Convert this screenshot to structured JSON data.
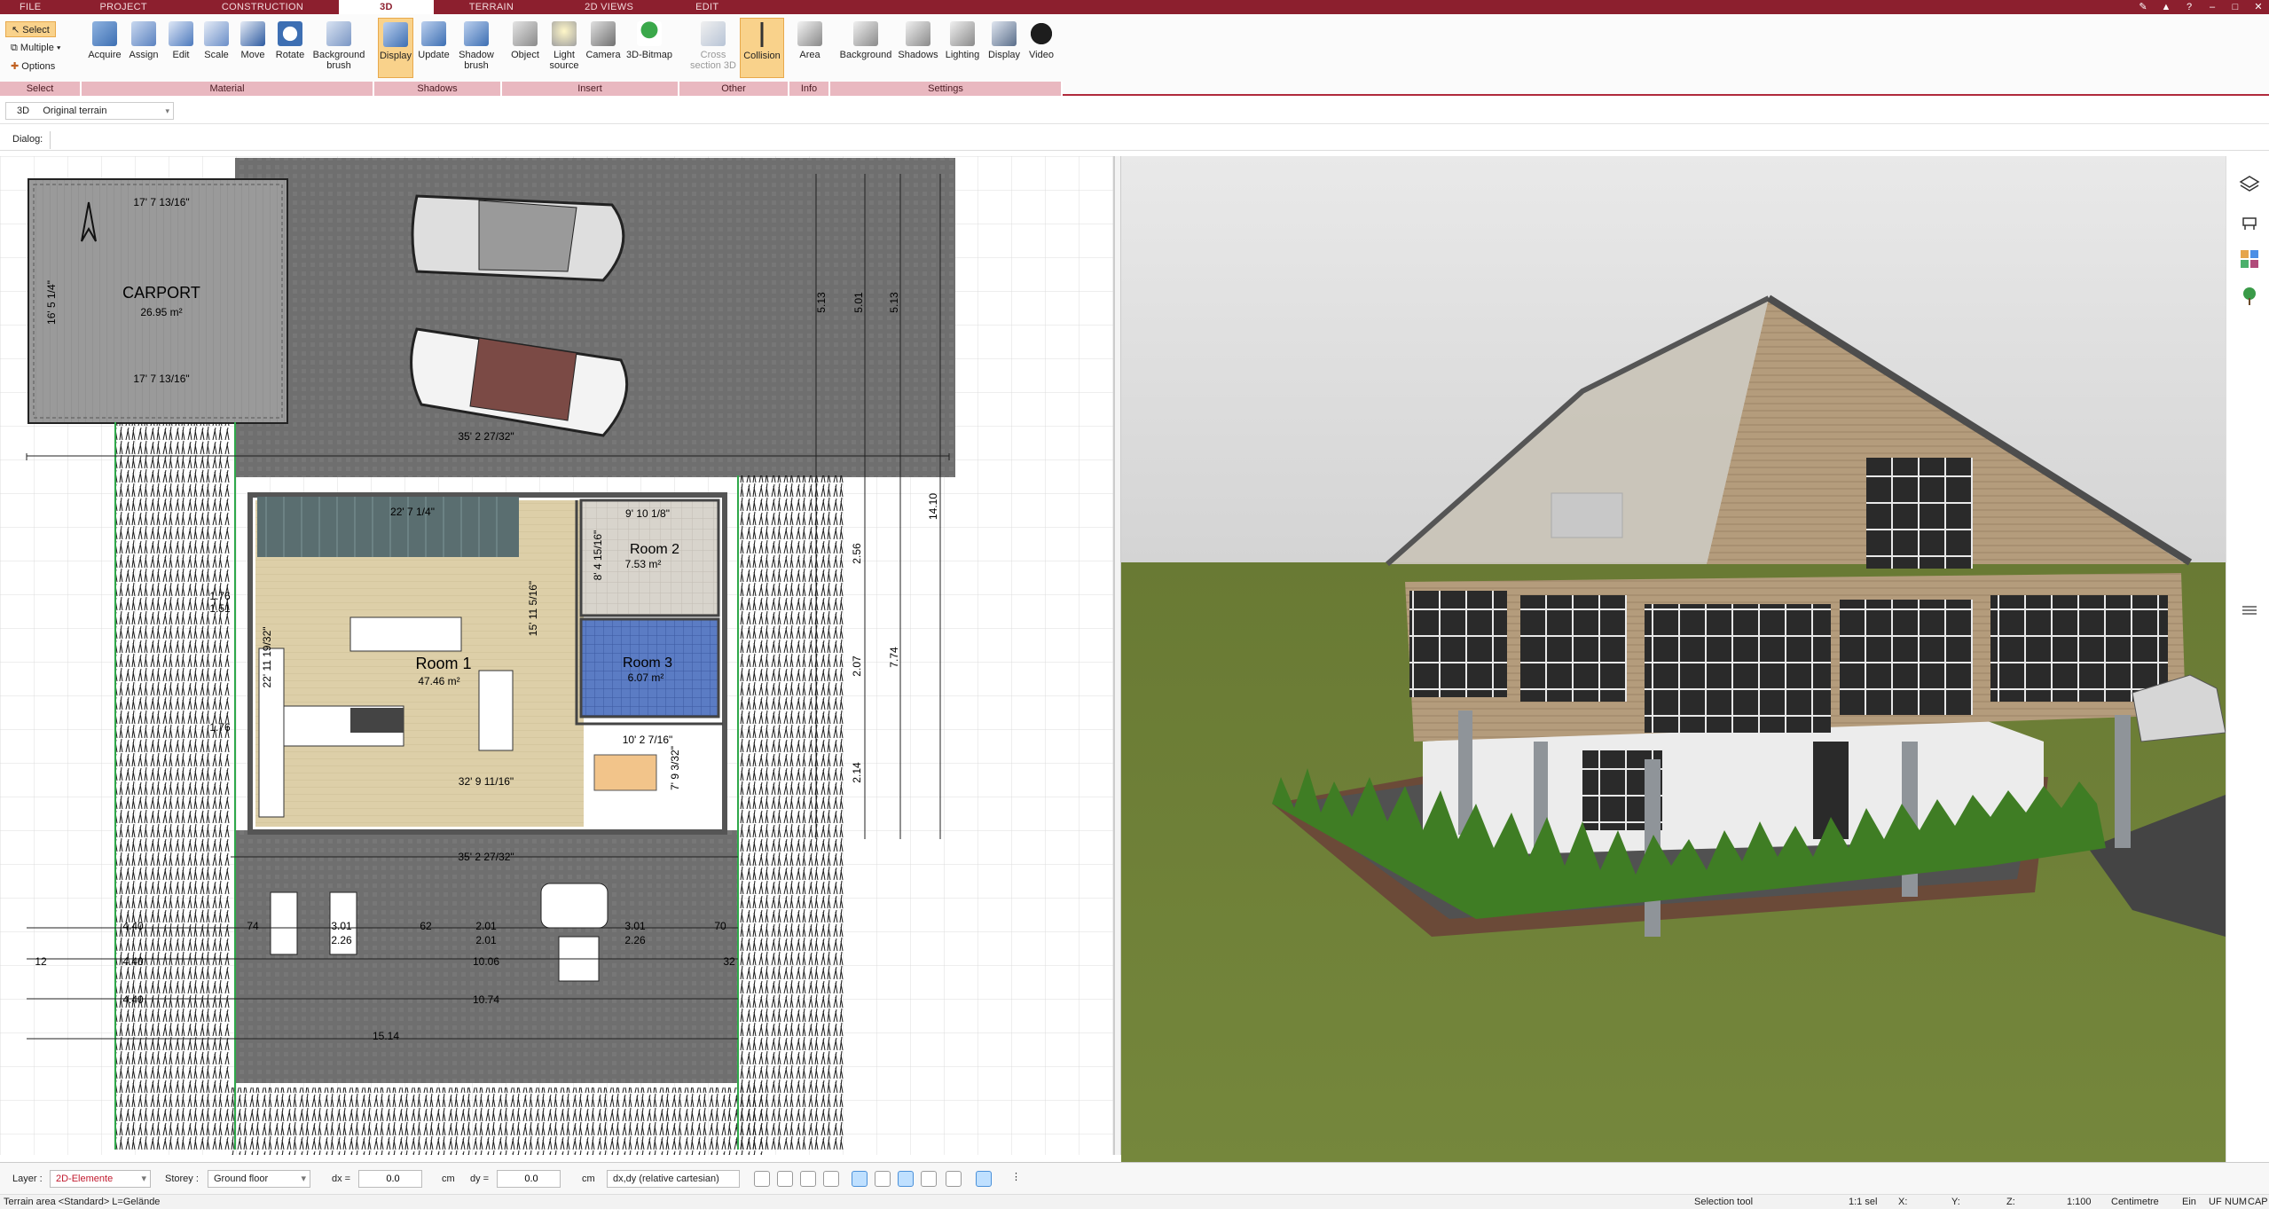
{
  "tabs": [
    "FILE",
    "PROJECT",
    "CONSTRUCTION",
    "3D",
    "TERRAIN",
    "2D VIEWS",
    "EDIT"
  ],
  "active_tab": "3D",
  "ribbon": {
    "select_group": {
      "label": "Select",
      "select": "Select",
      "multiple": "Multiple",
      "options": "Options"
    },
    "material_group": {
      "label": "Material",
      "buttons": [
        "Acquire",
        "Assign",
        "Edit",
        "Scale",
        "Move",
        "Rotate",
        "Background brush"
      ]
    },
    "shadows_group": {
      "label": "Shadows",
      "buttons": [
        "Display",
        "Update",
        "Shadow brush"
      ]
    },
    "insert_group": {
      "label": "Insert",
      "buttons": [
        "Object",
        "Light source",
        "Camera",
        "3D-Bitmap"
      ]
    },
    "other_group": {
      "label": "Other",
      "buttons": [
        "Cross section 3D",
        "Collision"
      ]
    },
    "info_group": {
      "label": "Info",
      "buttons": [
        "Area"
      ]
    },
    "settings_group": {
      "label": "Settings",
      "buttons": [
        "Background",
        "Shadows",
        "Lighting",
        "Display",
        "Video"
      ]
    }
  },
  "view_selector": {
    "mode": "3D",
    "value": "Original terrain"
  },
  "dialog_label": "Dialog:",
  "plan": {
    "carport": {
      "name": "CARPORT",
      "area": "26.95 m²",
      "dim_top": "17' 7 13/16\"",
      "dim_bottom": "17' 7 13/16\"",
      "dim_side": "16' 5 1/4\""
    },
    "room1": {
      "name": "Room 1",
      "area": "47.46 m²"
    },
    "room2": {
      "name": "Room 2",
      "area": "7.53 m²"
    },
    "room3": {
      "name": "Room 3",
      "area": "6.07 m²"
    },
    "dims": [
      "35' 2 27/32\"",
      "22' 7 1/4\"",
      "15' 11 5/16\"",
      "22' 11 19/32\"",
      "32' 9 11/16\"",
      "10' 2 7/16\"",
      "7' 9 3/32\"",
      "8' 4 15/16\"",
      "9' 10 1/8\"",
      "35' 2 27/32\"",
      "15.14",
      "10.74",
      "10.06",
      "4.40",
      "4.40",
      "4.40",
      "3.01",
      "3.01",
      "2.01",
      "2.01",
      "2.26",
      "2.26",
      "62",
      "74",
      "70",
      "12",
      "32",
      "5.13",
      "5.01",
      "5.13",
      "14.10",
      "7.74",
      "2.56",
      "2.07",
      "2.14",
      "1.76",
      "1.51",
      "1.76"
    ]
  },
  "statusbar": {
    "layer_label": "Layer :",
    "layer_value": "2D-Elemente",
    "storey_label": "Storey :",
    "storey_value": "Ground floor",
    "dx_label": "dx =",
    "dx_value": "0.0",
    "dx_unit": "cm",
    "dy_label": "dy =",
    "dy_value": "0.0",
    "dy_unit": "cm",
    "coord_mode": "dx,dy (relative cartesian)"
  },
  "bottombar": {
    "left": "Terrain area <Standard> L=Gelände",
    "tool": "Selection tool",
    "sel": "1:1 sel",
    "x": "X:",
    "y": "Y:",
    "z": "Z:",
    "scale": "1:100",
    "unit": "Centimetre",
    "ein": "Ein",
    "uf": "UF",
    "num": "NUM",
    "cap": "CAP"
  },
  "colors": {
    "brand": "#8c1f2e",
    "ribbon_group": "#e9b8c0",
    "selected": "#f9d28b",
    "lawn": "#6d7e37",
    "sky": "#d9d9d9"
  }
}
